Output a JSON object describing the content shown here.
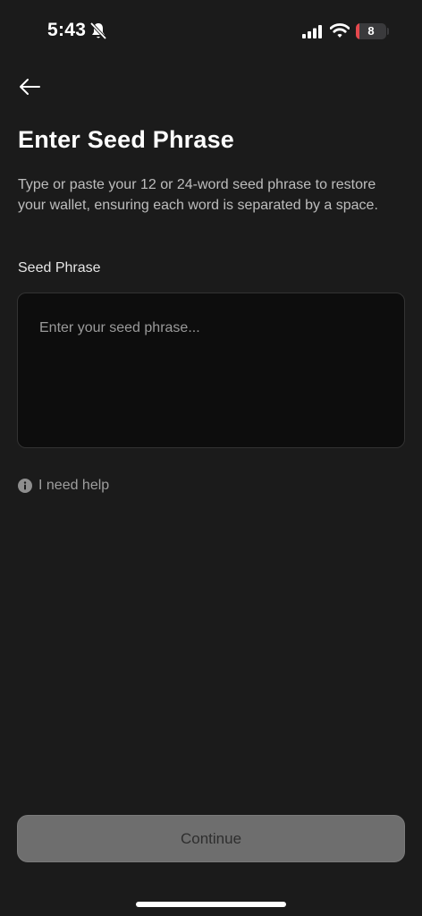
{
  "status_bar": {
    "time": "5:43",
    "battery_level": "8",
    "battery_fraction": 0.08,
    "icons": [
      "bell-slash-icon",
      "signal-icon",
      "wifi-icon",
      "battery-icon"
    ],
    "battery_color": "#e5484d"
  },
  "nav": {
    "back_icon": "arrow-left-icon"
  },
  "header": {
    "title": "Enter Seed Phrase",
    "description": "Type or paste your 12 or 24-word seed phrase to restore your wallet, ensuring each word is separated by a space."
  },
  "form": {
    "seed_label": "Seed Phrase",
    "seed_value": "",
    "seed_placeholder": "Enter your seed phrase..."
  },
  "help": {
    "icon": "info-icon",
    "label": "I need help"
  },
  "footer": {
    "continue_label": "Continue"
  },
  "colors": {
    "background": "#1b1b1b",
    "input_background": "#0d0d0d",
    "button_disabled": "#6e6e6e"
  }
}
